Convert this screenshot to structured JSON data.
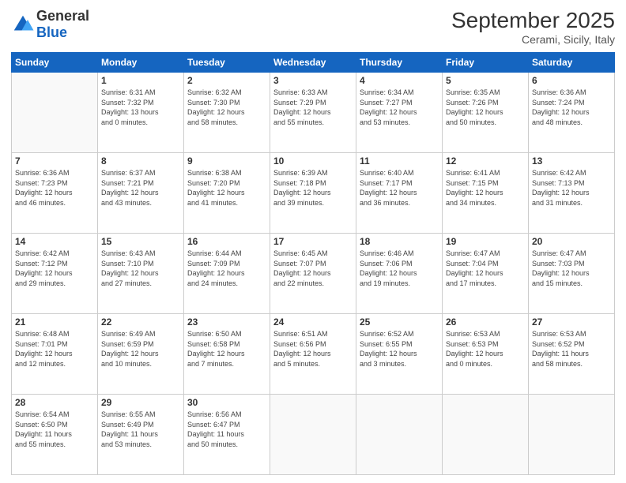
{
  "logo": {
    "general": "General",
    "blue": "Blue"
  },
  "title": "September 2025",
  "subtitle": "Cerami, Sicily, Italy",
  "days_of_week": [
    "Sunday",
    "Monday",
    "Tuesday",
    "Wednesday",
    "Thursday",
    "Friday",
    "Saturday"
  ],
  "weeks": [
    [
      {
        "day": "",
        "info": ""
      },
      {
        "day": "1",
        "info": "Sunrise: 6:31 AM\nSunset: 7:32 PM\nDaylight: 13 hours\nand 0 minutes."
      },
      {
        "day": "2",
        "info": "Sunrise: 6:32 AM\nSunset: 7:30 PM\nDaylight: 12 hours\nand 58 minutes."
      },
      {
        "day": "3",
        "info": "Sunrise: 6:33 AM\nSunset: 7:29 PM\nDaylight: 12 hours\nand 55 minutes."
      },
      {
        "day": "4",
        "info": "Sunrise: 6:34 AM\nSunset: 7:27 PM\nDaylight: 12 hours\nand 53 minutes."
      },
      {
        "day": "5",
        "info": "Sunrise: 6:35 AM\nSunset: 7:26 PM\nDaylight: 12 hours\nand 50 minutes."
      },
      {
        "day": "6",
        "info": "Sunrise: 6:36 AM\nSunset: 7:24 PM\nDaylight: 12 hours\nand 48 minutes."
      }
    ],
    [
      {
        "day": "7",
        "info": "Sunrise: 6:36 AM\nSunset: 7:23 PM\nDaylight: 12 hours\nand 46 minutes."
      },
      {
        "day": "8",
        "info": "Sunrise: 6:37 AM\nSunset: 7:21 PM\nDaylight: 12 hours\nand 43 minutes."
      },
      {
        "day": "9",
        "info": "Sunrise: 6:38 AM\nSunset: 7:20 PM\nDaylight: 12 hours\nand 41 minutes."
      },
      {
        "day": "10",
        "info": "Sunrise: 6:39 AM\nSunset: 7:18 PM\nDaylight: 12 hours\nand 39 minutes."
      },
      {
        "day": "11",
        "info": "Sunrise: 6:40 AM\nSunset: 7:17 PM\nDaylight: 12 hours\nand 36 minutes."
      },
      {
        "day": "12",
        "info": "Sunrise: 6:41 AM\nSunset: 7:15 PM\nDaylight: 12 hours\nand 34 minutes."
      },
      {
        "day": "13",
        "info": "Sunrise: 6:42 AM\nSunset: 7:13 PM\nDaylight: 12 hours\nand 31 minutes."
      }
    ],
    [
      {
        "day": "14",
        "info": "Sunrise: 6:42 AM\nSunset: 7:12 PM\nDaylight: 12 hours\nand 29 minutes."
      },
      {
        "day": "15",
        "info": "Sunrise: 6:43 AM\nSunset: 7:10 PM\nDaylight: 12 hours\nand 27 minutes."
      },
      {
        "day": "16",
        "info": "Sunrise: 6:44 AM\nSunset: 7:09 PM\nDaylight: 12 hours\nand 24 minutes."
      },
      {
        "day": "17",
        "info": "Sunrise: 6:45 AM\nSunset: 7:07 PM\nDaylight: 12 hours\nand 22 minutes."
      },
      {
        "day": "18",
        "info": "Sunrise: 6:46 AM\nSunset: 7:06 PM\nDaylight: 12 hours\nand 19 minutes."
      },
      {
        "day": "19",
        "info": "Sunrise: 6:47 AM\nSunset: 7:04 PM\nDaylight: 12 hours\nand 17 minutes."
      },
      {
        "day": "20",
        "info": "Sunrise: 6:47 AM\nSunset: 7:03 PM\nDaylight: 12 hours\nand 15 minutes."
      }
    ],
    [
      {
        "day": "21",
        "info": "Sunrise: 6:48 AM\nSunset: 7:01 PM\nDaylight: 12 hours\nand 12 minutes."
      },
      {
        "day": "22",
        "info": "Sunrise: 6:49 AM\nSunset: 6:59 PM\nDaylight: 12 hours\nand 10 minutes."
      },
      {
        "day": "23",
        "info": "Sunrise: 6:50 AM\nSunset: 6:58 PM\nDaylight: 12 hours\nand 7 minutes."
      },
      {
        "day": "24",
        "info": "Sunrise: 6:51 AM\nSunset: 6:56 PM\nDaylight: 12 hours\nand 5 minutes."
      },
      {
        "day": "25",
        "info": "Sunrise: 6:52 AM\nSunset: 6:55 PM\nDaylight: 12 hours\nand 3 minutes."
      },
      {
        "day": "26",
        "info": "Sunrise: 6:53 AM\nSunset: 6:53 PM\nDaylight: 12 hours\nand 0 minutes."
      },
      {
        "day": "27",
        "info": "Sunrise: 6:53 AM\nSunset: 6:52 PM\nDaylight: 11 hours\nand 58 minutes."
      }
    ],
    [
      {
        "day": "28",
        "info": "Sunrise: 6:54 AM\nSunset: 6:50 PM\nDaylight: 11 hours\nand 55 minutes."
      },
      {
        "day": "29",
        "info": "Sunrise: 6:55 AM\nSunset: 6:49 PM\nDaylight: 11 hours\nand 53 minutes."
      },
      {
        "day": "30",
        "info": "Sunrise: 6:56 AM\nSunset: 6:47 PM\nDaylight: 11 hours\nand 50 minutes."
      },
      {
        "day": "",
        "info": ""
      },
      {
        "day": "",
        "info": ""
      },
      {
        "day": "",
        "info": ""
      },
      {
        "day": "",
        "info": ""
      }
    ]
  ]
}
